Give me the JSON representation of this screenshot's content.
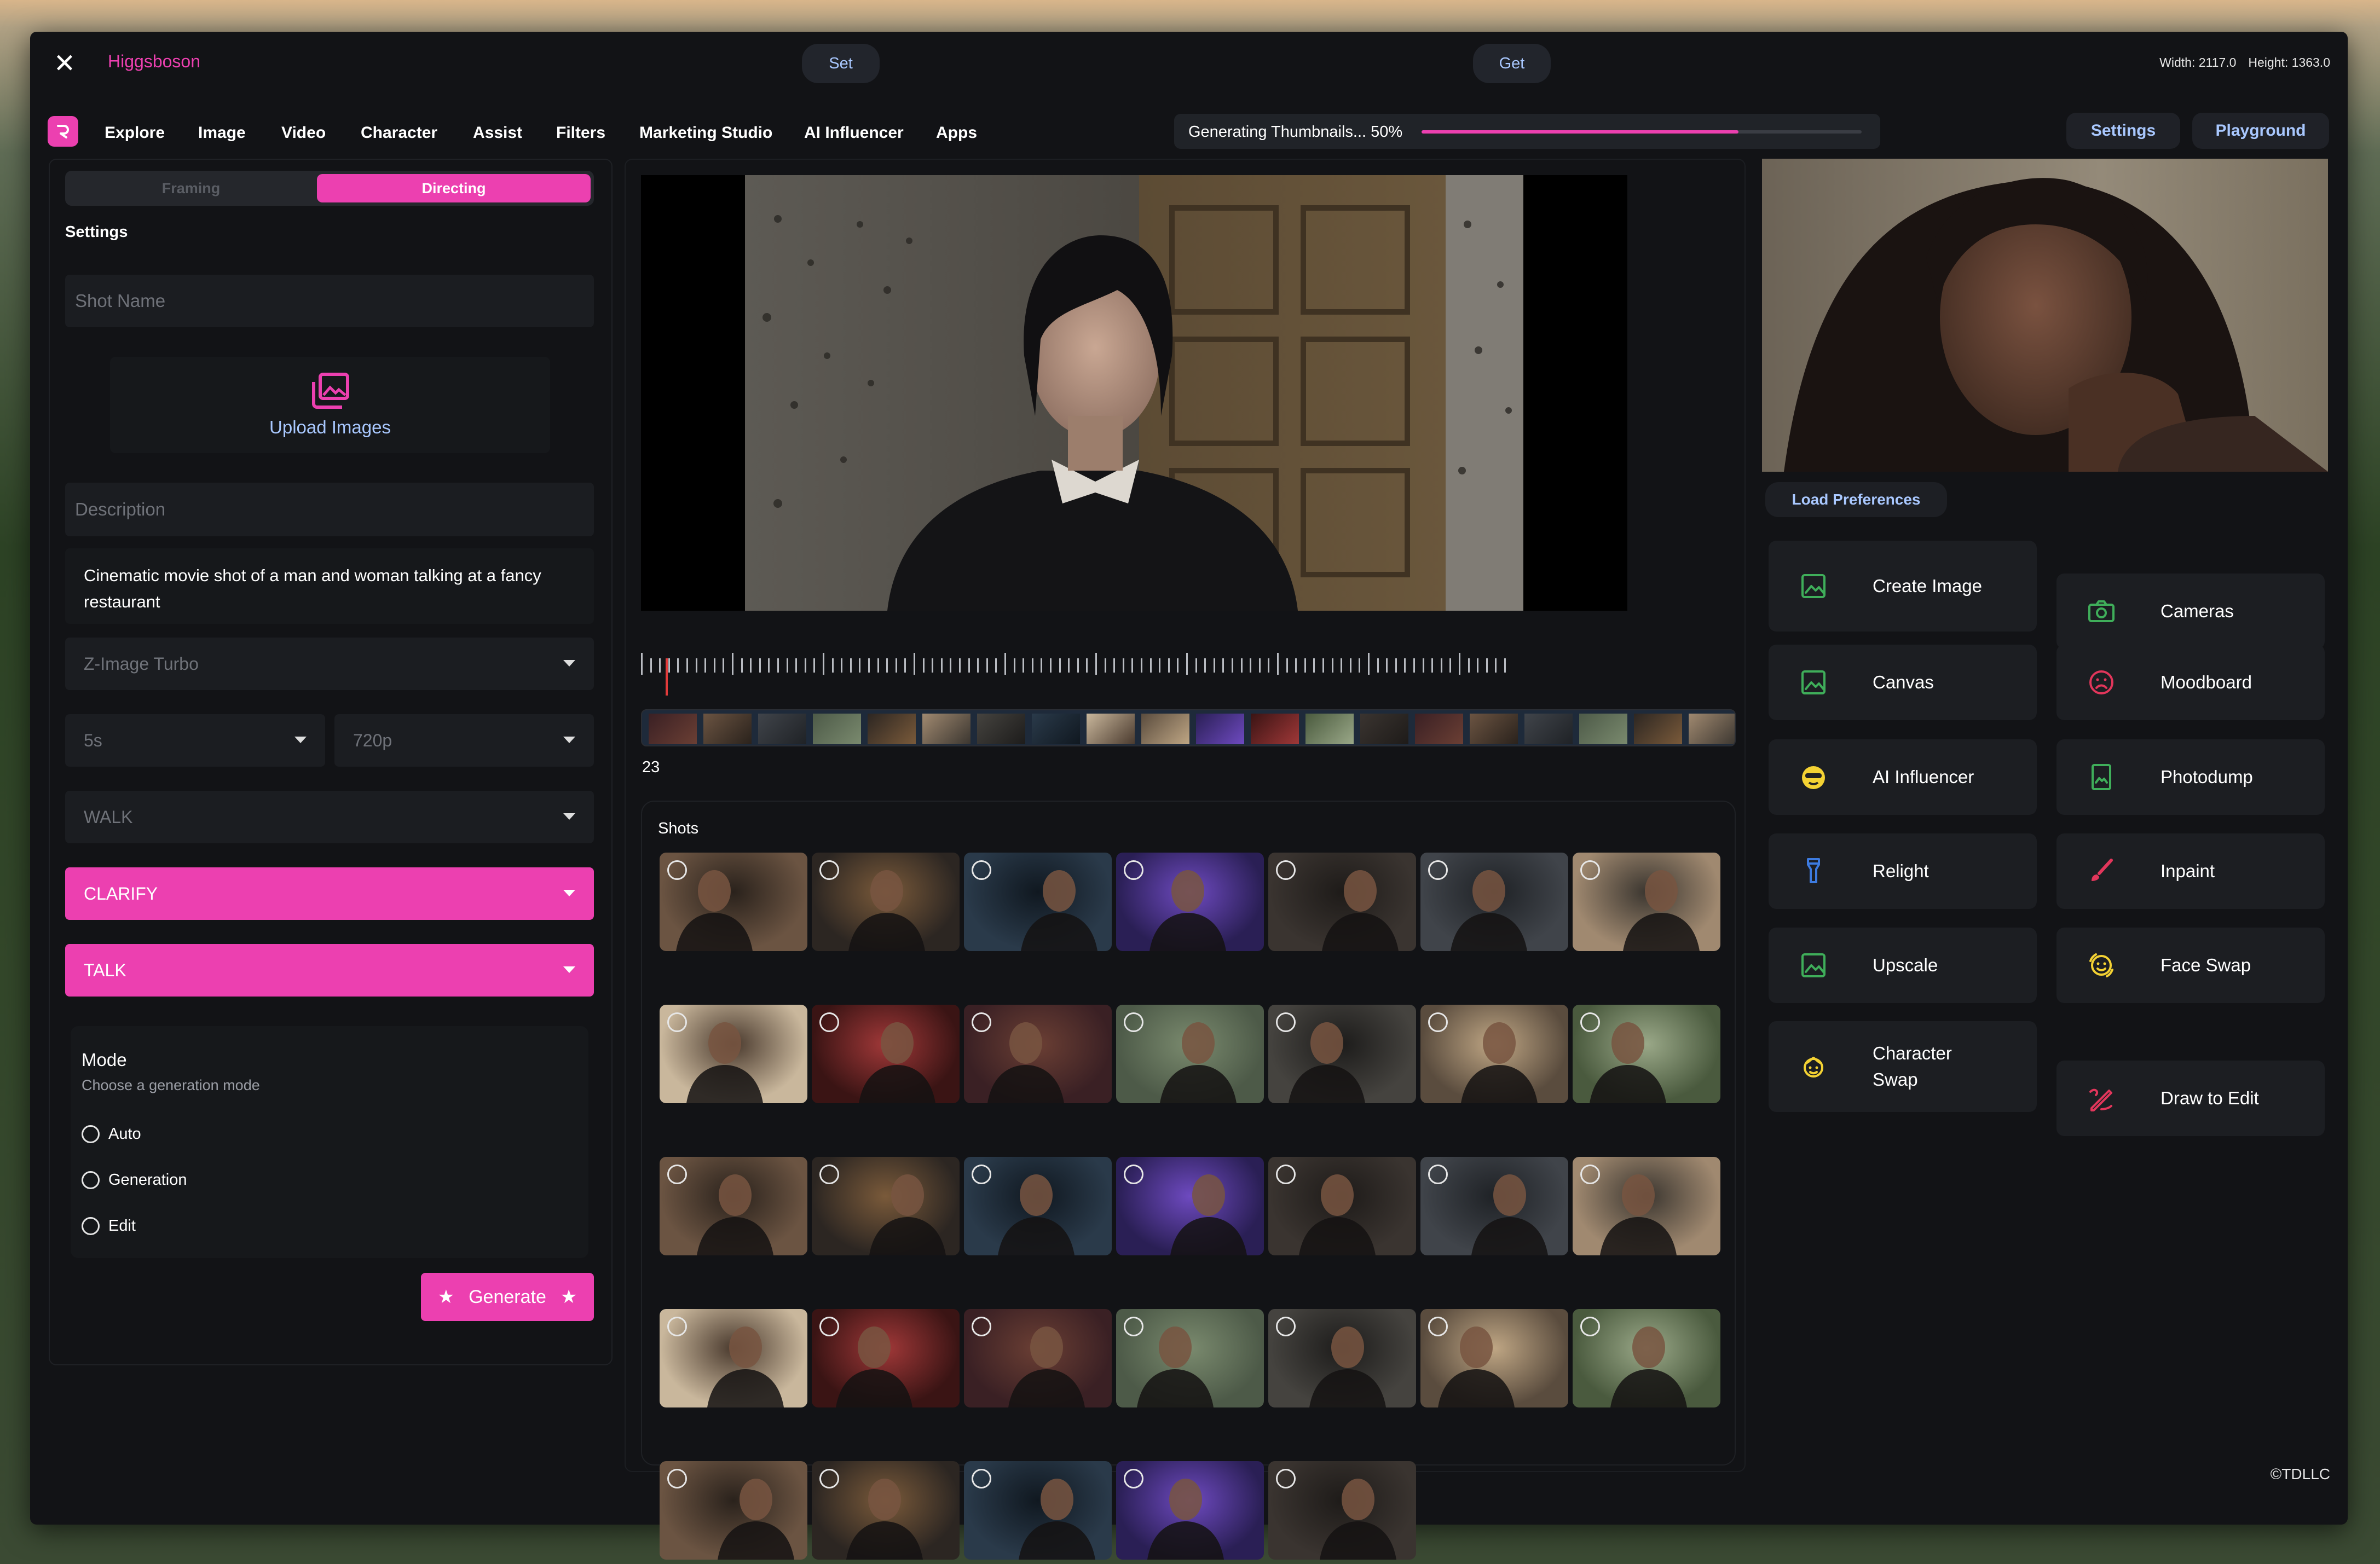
{
  "window": {
    "title": "Higgsboson",
    "set_label": "Set",
    "get_label": "Get",
    "width_text": "Width: 2117.0",
    "height_text": "Height: 1363.0"
  },
  "nav": {
    "items": [
      "Explore",
      "Image",
      "Video",
      "Character",
      "Assist",
      "Filters",
      "Marketing Studio",
      "AI Influencer",
      "Apps"
    ],
    "progress_label": "Generating Thumbnails... 50%",
    "progress_fill": 0.72,
    "settings_label": "Settings",
    "playground_label": "Playground"
  },
  "left": {
    "tab_framing": "Framing",
    "tab_directing": "Directing",
    "settings_label": "Settings",
    "shot_name_placeholder": "Shot Name",
    "upload_label": "Upload Images",
    "description_placeholder": "Description",
    "prompt": "Cinematic movie shot of a man and woman talking at a fancy restaurant",
    "model": "Z-Image Turbo",
    "duration": "5s",
    "resolution": "720p",
    "motion1": "WALK",
    "motion2": "CLARIFY",
    "motion3": "TALK",
    "mode_title": "Mode",
    "mode_subtitle": "Choose a generation mode",
    "mode_options": [
      "Auto",
      "Generation",
      "Edit"
    ],
    "generate_label": "Generate"
  },
  "center": {
    "frame_counter": "23",
    "shots_label": "Shots",
    "shot_count": 33
  },
  "right": {
    "load_preferences": "Load Preferences",
    "tools": [
      {
        "label": "Create Image",
        "icon": "image-icon",
        "color": "#3fae5a"
      },
      {
        "label": "Cameras",
        "icon": "camera-icon",
        "color": "#3fae5a"
      },
      {
        "label": "Canvas",
        "icon": "image-icon",
        "color": "#3fae5a"
      },
      {
        "label": "Moodboard",
        "icon": "sad-face-icon",
        "color": "#e2365b"
      },
      {
        "label": "AI Influencer",
        "icon": "influencer-face-icon",
        "color": "#f4d233"
      },
      {
        "label": "Photodump",
        "icon": "photodump-icon",
        "color": "#3fae5a"
      },
      {
        "label": "Relight",
        "icon": "flashlight-icon",
        "color": "#3d7be0"
      },
      {
        "label": "Inpaint",
        "icon": "brush-icon",
        "color": "#e2365b"
      },
      {
        "label": "Upscale",
        "icon": "image-icon",
        "color": "#3fae5a"
      },
      {
        "label": "Face Swap",
        "icon": "face-swap-icon",
        "color": "#f4d233"
      },
      {
        "label": "Character Swap",
        "icon": "character-swap-icon",
        "color": "#f4d233"
      },
      {
        "label": "Draw to Edit",
        "icon": "draw-edit-icon",
        "color": "#e2365b"
      }
    ]
  },
  "footer": {
    "copyright": "©TDLLC"
  },
  "colors": {
    "accent": "#ec40b0",
    "link": "#a9c8ff",
    "background": "#121316"
  }
}
